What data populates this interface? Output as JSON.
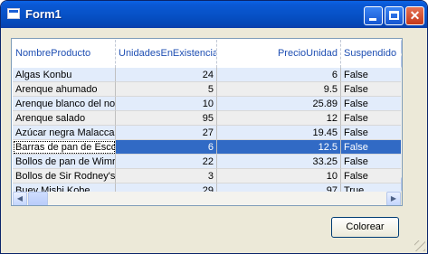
{
  "window": {
    "title": "Form1",
    "minimize_glyph": "",
    "maximize_glyph": "",
    "close_glyph": "✕"
  },
  "grid": {
    "columns": [
      "NombreProducto",
      "UnidadesEnExistencia",
      "PrecioUnidad",
      "Suspendido"
    ],
    "rows": [
      [
        "Algas Konbu",
        "24",
        "6",
        "False"
      ],
      [
        "Arenque ahumado",
        "5",
        "9.5",
        "False"
      ],
      [
        "Arenque blanco del no",
        "10",
        "25.89",
        "False"
      ],
      [
        "Arenque salado",
        "95",
        "12",
        "False"
      ],
      [
        "Azúcar negra Malacca",
        "27",
        "19.45",
        "False"
      ],
      [
        "Barras de pan de Escc",
        "6",
        "12.5",
        "False"
      ],
      [
        "Bollos de pan de Wimr",
        "22",
        "33.25",
        "False"
      ],
      [
        "Bollos de Sir Rodney's",
        "3",
        "10",
        "False"
      ],
      [
        "Buey Mishi Kobe",
        "29",
        "97",
        "True"
      ]
    ],
    "selected_row_index": 5
  },
  "scroll": {
    "up_arrow": "▲",
    "down_arrow": "▼",
    "left_arrow": "◀",
    "right_arrow": "▶"
  },
  "buttons": {
    "colorear": "Colorear"
  },
  "colors": {
    "title_bar": "#0752c7",
    "row_blue": "#e2ecfb",
    "row_gray": "#eeeeee",
    "selection": "#316ac5",
    "header_text": "#1f4fb3"
  }
}
